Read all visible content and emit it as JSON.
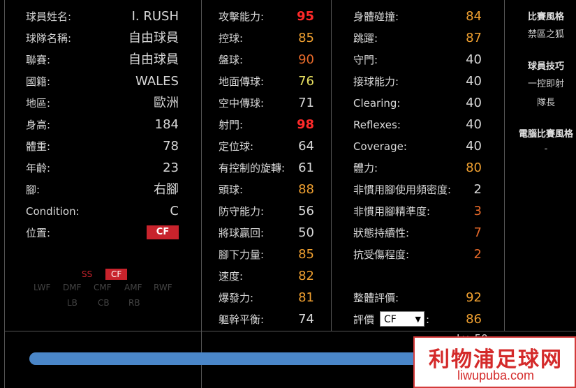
{
  "profile": {
    "rows": [
      {
        "label": "球員姓名:",
        "value": "I. RUSH"
      },
      {
        "label": "球隊名稱:",
        "value": "自由球員"
      },
      {
        "label": "聯賽:",
        "value": "自由球員"
      },
      {
        "label": "國籍:",
        "value": "WALES"
      },
      {
        "label": "地區:",
        "value": "歐洲"
      },
      {
        "label": "身高:",
        "value": "184"
      },
      {
        "label": "體重:",
        "value": "78"
      },
      {
        "label": "年齡:",
        "value": "23"
      },
      {
        "label": "腳:",
        "value": "右腳"
      },
      {
        "label": "Condition:",
        "value": "C"
      }
    ],
    "position_label": "位置:",
    "position_value": "CF"
  },
  "mini_positions": {
    "row1": [
      "SS",
      "CF"
    ],
    "row2": [
      "LWF",
      "DMF",
      "CMF",
      "AMF",
      "RWF"
    ],
    "row3": [
      "LB",
      "CB",
      "RB"
    ]
  },
  "attributes_mid": [
    {
      "label": "攻擊能力:",
      "value": "95",
      "tone": "red"
    },
    {
      "label": "控球:",
      "value": "85",
      "tone": "orange"
    },
    {
      "label": "盤球:",
      "value": "90",
      "tone": "deep"
    },
    {
      "label": "地面傳球:",
      "value": "76",
      "tone": "yellow"
    },
    {
      "label": "空中傳球:",
      "value": "71",
      "tone": "white"
    },
    {
      "label": "射門:",
      "value": "98",
      "tone": "red"
    },
    {
      "label": "定位球:",
      "value": "64",
      "tone": "white"
    },
    {
      "label": "有控制的旋轉:",
      "value": "61",
      "tone": "white"
    },
    {
      "label": "頭球:",
      "value": "88",
      "tone": "orange"
    },
    {
      "label": "防守能力:",
      "value": "56",
      "tone": "white"
    },
    {
      "label": "將球贏回:",
      "value": "50",
      "tone": "white"
    },
    {
      "label": "腳下力量:",
      "value": "85",
      "tone": "orange"
    },
    {
      "label": "速度:",
      "value": "82",
      "tone": "orange"
    },
    {
      "label": "爆發力:",
      "value": "81",
      "tone": "orange"
    },
    {
      "label": "軀幹平衡:",
      "value": "74",
      "tone": "white"
    }
  ],
  "attributes_right": [
    {
      "label": "身體碰撞:",
      "value": "84",
      "tone": "orange"
    },
    {
      "label": "跳躍:",
      "value": "87",
      "tone": "orange"
    },
    {
      "label": "守門:",
      "value": "40",
      "tone": "white"
    },
    {
      "label": "接球能力:",
      "value": "40",
      "tone": "white"
    },
    {
      "label": "Clearing:",
      "value": "40",
      "tone": "white"
    },
    {
      "label": "Reflexes:",
      "value": "40",
      "tone": "white"
    },
    {
      "label": "Coverage:",
      "value": "40",
      "tone": "white"
    },
    {
      "label": "體力:",
      "value": "80",
      "tone": "orange"
    },
    {
      "label": "非慣用腳使用頻密度:",
      "value": "2",
      "tone": "white"
    },
    {
      "label": "非慣用腳精準度:",
      "value": "3",
      "tone": "deep"
    },
    {
      "label": "狀態持續性:",
      "value": "7",
      "tone": "deep"
    },
    {
      "label": "抗受傷程度:",
      "value": "2",
      "tone": "deep"
    }
  ],
  "overall": {
    "label": "整體評價:",
    "value": "92"
  },
  "rating": {
    "label": "評價",
    "select_value": "CF",
    "suffix": ":",
    "value": "86"
  },
  "side": {
    "style_title": "比賽風格",
    "style_value": "禁區之狐",
    "skills_title": "球員技巧",
    "skills": [
      "一控即射",
      "隊長"
    ],
    "ai_title": "電腦比賽風格",
    "ai_value": "-"
  },
  "bottom": {
    "level_text": "Lv. 50",
    "bar_fraction": 0.94
  },
  "watermark": {
    "main": "利物浦足球网",
    "sub": "liwupuba.com"
  },
  "colors": {
    "red": "#ff2a2a",
    "orange": "#f0a030",
    "yellow": "#e8e060",
    "badge": "#c8232c",
    "bar": "#4a86c8"
  }
}
